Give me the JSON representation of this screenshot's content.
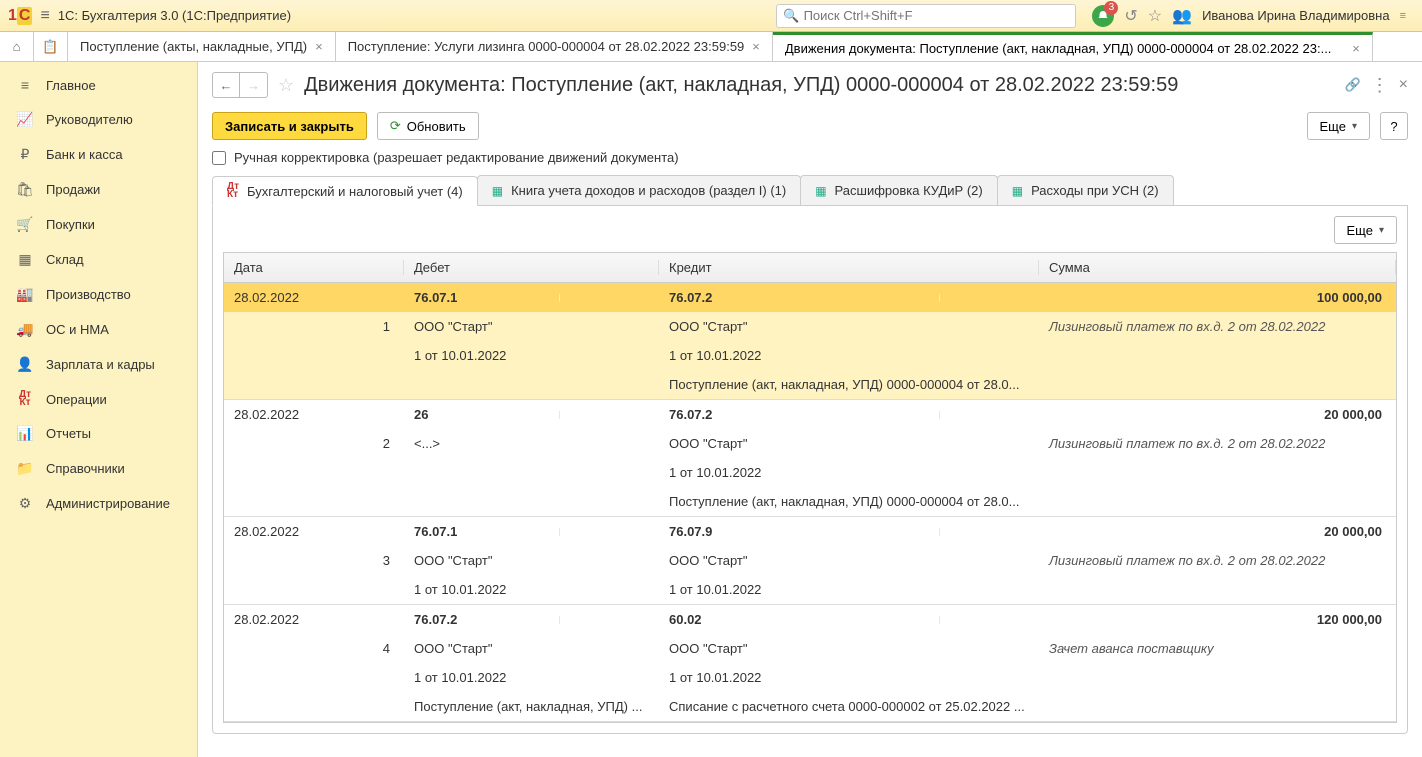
{
  "app": {
    "title": "1С: Бухгалтерия 3.0  (1С:Предприятие)"
  },
  "search": {
    "placeholder": "Поиск Ctrl+Shift+F"
  },
  "notifications": {
    "count": "3"
  },
  "user": {
    "name": "Иванова Ирина Владимировна"
  },
  "tabs": [
    {
      "label": "Поступление (акты, накладные, УПД)"
    },
    {
      "label": "Поступление: Услуги лизинга 0000-000004 от 28.02.2022 23:59:59"
    },
    {
      "label": "Движения документа: Поступление (акт, накладная, УПД) 0000-000004 от 28.02.2022 23:..."
    }
  ],
  "sidebar": {
    "items": [
      {
        "label": "Главное"
      },
      {
        "label": "Руководителю"
      },
      {
        "label": "Банк и касса"
      },
      {
        "label": "Продажи"
      },
      {
        "label": "Покупки"
      },
      {
        "label": "Склад"
      },
      {
        "label": "Производство"
      },
      {
        "label": "ОС и НМА"
      },
      {
        "label": "Зарплата и кадры"
      },
      {
        "label": "Операции"
      },
      {
        "label": "Отчеты"
      },
      {
        "label": "Справочники"
      },
      {
        "label": "Администрирование"
      }
    ]
  },
  "page": {
    "title": "Движения документа: Поступление (акт, накладная, УПД) 0000-000004 от 28.02.2022 23:59:59",
    "save_close": "Записать и закрыть",
    "refresh": "Обновить",
    "more": "Еще",
    "help": "?",
    "manual_edit": "Ручная корректировка (разрешает редактирование движений документа)"
  },
  "inner_tabs": [
    {
      "label": "Бухгалтерский и налоговый учет (4)"
    },
    {
      "label": "Книга учета доходов и расходов (раздел I) (1)"
    },
    {
      "label": "Расшифровка КУДиР (2)"
    },
    {
      "label": "Расходы при УСН (2)"
    }
  ],
  "panel": {
    "more": "Еще"
  },
  "columns": {
    "date": "Дата",
    "debit": "Дебет",
    "credit": "Кредит",
    "sum": "Сумма"
  },
  "entries": [
    {
      "date": "28.02.2022",
      "n": "1",
      "debit_acc": "76.07.1",
      "credit_acc": "76.07.2",
      "sum": "100 000,00",
      "debit_l1": "ООО \"Старт\"",
      "credit_l1": "ООО \"Старт\"",
      "desc": "Лизинговый платеж по вх.д. 2 от 28.02.2022",
      "debit_l2": "1 от 10.01.2022",
      "credit_l2": "1 от 10.01.2022",
      "credit_l3": "Поступление (акт, накладная, УПД) 0000-000004 от 28.0..."
    },
    {
      "date": "28.02.2022",
      "n": "2",
      "debit_acc": "26",
      "credit_acc": "76.07.2",
      "sum": "20 000,00",
      "debit_l1": "<...>",
      "credit_l1": "ООО \"Старт\"",
      "desc": "Лизинговый платеж по вх.д. 2 от 28.02.2022",
      "credit_l2": "1 от 10.01.2022",
      "credit_l3": "Поступление (акт, накладная, УПД) 0000-000004 от 28.0..."
    },
    {
      "date": "28.02.2022",
      "n": "3",
      "debit_acc": "76.07.1",
      "credit_acc": "76.07.9",
      "sum": "20 000,00",
      "debit_l1": "ООО \"Старт\"",
      "credit_l1": "ООО \"Старт\"",
      "desc": "Лизинговый платеж по вх.д. 2 от 28.02.2022",
      "debit_l2": "1 от 10.01.2022",
      "credit_l2": "1 от 10.01.2022"
    },
    {
      "date": "28.02.2022",
      "n": "4",
      "debit_acc": "76.07.2",
      "credit_acc": "60.02",
      "sum": "120 000,00",
      "debit_l1": "ООО \"Старт\"",
      "credit_l1": "ООО \"Старт\"",
      "desc": "Зачет аванса поставщику",
      "debit_l2": "1 от 10.01.2022",
      "credit_l2": "1 от 10.01.2022",
      "debit_l3": "Поступление (акт, накладная, УПД) ...",
      "credit_l3": "Списание с расчетного счета 0000-000002 от 25.02.2022 ..."
    }
  ]
}
